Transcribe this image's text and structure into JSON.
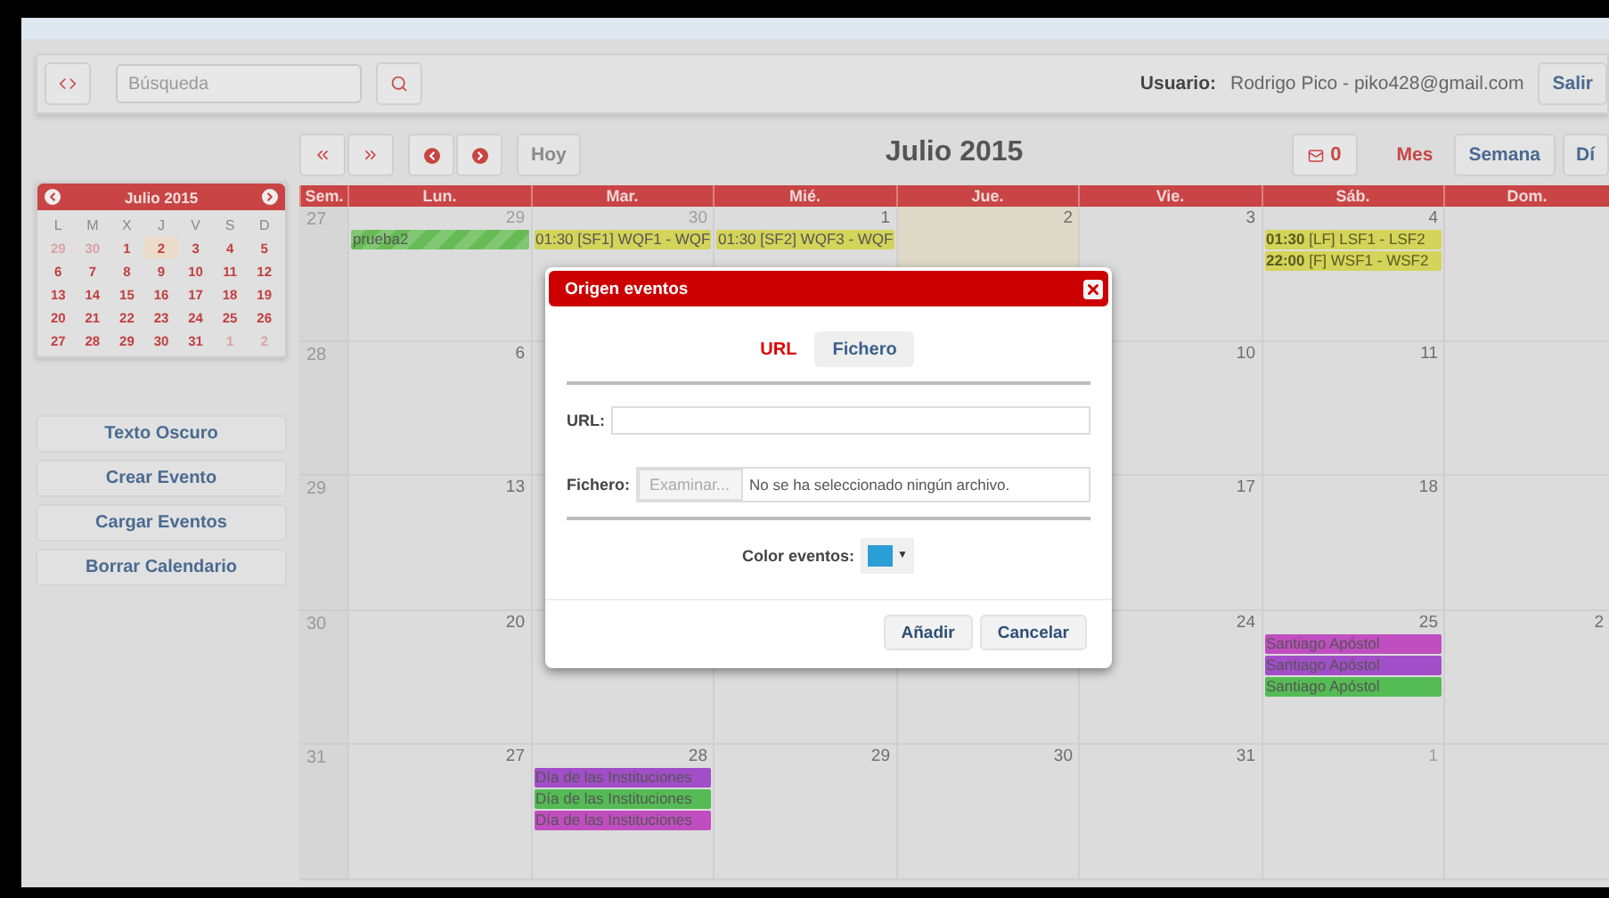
{
  "top_bar": {
    "search": {
      "placeholder": "Búsqueda"
    },
    "user_label": "Usuario:",
    "user_value": "Rodrigo Pico - piko428@gmail.com",
    "logout": "Salir"
  },
  "toolbar": {
    "today": {
      "label": "Hoy",
      "disabled": true
    },
    "title": "Julio 2015",
    "notifications": "0",
    "views": [
      {
        "label": "Mes",
        "selected": true
      },
      {
        "label": "Semana",
        "selected": false
      },
      {
        "label": "Dí",
        "selected": false
      }
    ]
  },
  "mini_calendar": {
    "title": "Julio 2015",
    "weekdays": [
      "L",
      "M",
      "X",
      "J",
      "V",
      "S",
      "D"
    ],
    "weeks": [
      [
        {
          "label": "29",
          "other_month": true,
          "today": false
        },
        {
          "label": "30",
          "other_month": true,
          "today": false
        },
        {
          "label": "1",
          "other_month": false,
          "today": false
        },
        {
          "label": "2",
          "other_month": false,
          "today": true
        },
        {
          "label": "3",
          "other_month": false,
          "today": false
        },
        {
          "label": "4",
          "other_month": false,
          "today": false
        },
        {
          "label": "5",
          "other_month": false,
          "today": false
        }
      ],
      [
        {
          "label": "6",
          "other_month": false,
          "today": false
        },
        {
          "label": "7",
          "other_month": false,
          "today": false
        },
        {
          "label": "8",
          "other_month": false,
          "today": false
        },
        {
          "label": "9",
          "other_month": false,
          "today": false
        },
        {
          "label": "10",
          "other_month": false,
          "today": false
        },
        {
          "label": "11",
          "other_month": false,
          "today": false
        },
        {
          "label": "12",
          "other_month": false,
          "today": false
        }
      ],
      [
        {
          "label": "13",
          "other_month": false,
          "today": false
        },
        {
          "label": "14",
          "other_month": false,
          "today": false
        },
        {
          "label": "15",
          "other_month": false,
          "today": false
        },
        {
          "label": "16",
          "other_month": false,
          "today": false
        },
        {
          "label": "17",
          "other_month": false,
          "today": false
        },
        {
          "label": "18",
          "other_month": false,
          "today": false
        },
        {
          "label": "19",
          "other_month": false,
          "today": false
        }
      ],
      [
        {
          "label": "20",
          "other_month": false,
          "today": false
        },
        {
          "label": "21",
          "other_month": false,
          "today": false
        },
        {
          "label": "22",
          "other_month": false,
          "today": false
        },
        {
          "label": "23",
          "other_month": false,
          "today": false
        },
        {
          "label": "24",
          "other_month": false,
          "today": false
        },
        {
          "label": "25",
          "other_month": false,
          "today": false
        },
        {
          "label": "26",
          "other_month": false,
          "today": false
        }
      ],
      [
        {
          "label": "27",
          "other_month": false,
          "today": false
        },
        {
          "label": "28",
          "other_month": false,
          "today": false
        },
        {
          "label": "29",
          "other_month": false,
          "today": false
        },
        {
          "label": "30",
          "other_month": false,
          "today": false
        },
        {
          "label": "31",
          "other_month": false,
          "today": false
        },
        {
          "label": "1",
          "other_month": true,
          "today": false
        },
        {
          "label": "2",
          "other_month": true,
          "today": false
        }
      ]
    ]
  },
  "sidebar_buttons": [
    "Texto Oscuro",
    "Crear Evento",
    "Cargar Eventos",
    "Borrar Calendario"
  ],
  "calendar": {
    "columns": [
      "Sem.",
      "Lun.",
      "Mar.",
      "Mié.",
      "Jue.",
      "Vie.",
      "Sáb.",
      "Dom."
    ],
    "weeks": [
      {
        "week": "27",
        "days": [
          {
            "kind": "day",
            "day": "29",
            "other_month": true,
            "today": false,
            "events": [
              {
                "kind": "striped",
                "text": "prueba2",
                "color": "#66bb55"
              }
            ]
          },
          {
            "kind": "day",
            "day": "30",
            "other_month": true,
            "today": false,
            "events": [
              {
                "kind": "plain",
                "text": "01:30 [SF1] WQF1 - WQF",
                "color": "#d4d45a"
              }
            ]
          },
          {
            "kind": "day",
            "day": "1",
            "other_month": false,
            "today": false,
            "events": [
              {
                "kind": "plain",
                "text": "01:30 [SF2] WQF3 - WQF",
                "color": "#d4d45a"
              }
            ]
          },
          {
            "kind": "day",
            "day": "2",
            "other_month": false,
            "today": true
          },
          {
            "kind": "day",
            "day": "3",
            "other_month": false,
            "today": false
          },
          {
            "kind": "day",
            "day": "4",
            "other_month": false,
            "today": false,
            "events": [
              {
                "kind": "timed",
                "time": "01:30",
                "text": "[LF] LSF1 - LSF2",
                "color": "#d4d45a"
              },
              {
                "kind": "timed",
                "time": "22:00",
                "text": "[F] WSF1 - WSF2",
                "color": "#d4d45a"
              }
            ]
          },
          {
            "kind": "hidden"
          }
        ]
      },
      {
        "week": "28",
        "days": [
          {
            "kind": "day",
            "day": "6",
            "other_month": false,
            "today": false
          },
          {
            "kind": "hidden"
          },
          {
            "kind": "covered"
          },
          {
            "kind": "covered"
          },
          {
            "kind": "day",
            "day": "10",
            "other_month": false,
            "today": false
          },
          {
            "kind": "day",
            "day": "11",
            "other_month": false,
            "today": false
          },
          {
            "kind": "hidden"
          }
        ]
      },
      {
        "week": "29",
        "days": [
          {
            "kind": "day",
            "day": "13",
            "other_month": false,
            "today": false
          },
          {
            "kind": "hidden"
          },
          {
            "kind": "covered"
          },
          {
            "kind": "covered"
          },
          {
            "kind": "day",
            "day": "17",
            "other_month": false,
            "today": false
          },
          {
            "kind": "day",
            "day": "18",
            "other_month": false,
            "today": false
          },
          {
            "kind": "hidden"
          }
        ]
      },
      {
        "week": "30",
        "days": [
          {
            "kind": "day",
            "day": "20",
            "other_month": false,
            "today": false
          },
          {
            "kind": "hidden"
          },
          {
            "kind": "hidden"
          },
          {
            "kind": "hidden"
          },
          {
            "kind": "day",
            "day": "24",
            "other_month": false,
            "today": false
          },
          {
            "kind": "day",
            "day": "25",
            "other_month": false,
            "today": false,
            "events": [
              {
                "kind": "plain",
                "text": "Santiago Apóstol",
                "color": "#c04ec0"
              },
              {
                "kind": "plain",
                "text": "Santiago Apóstol",
                "color": "#a24ec8"
              },
              {
                "kind": "plain",
                "text": "Santiago Apóstol",
                "color": "#55bb55"
              }
            ]
          },
          {
            "kind": "day",
            "day": "2",
            "other_month": false,
            "today": false
          }
        ]
      },
      {
        "week": "31",
        "days": [
          {
            "kind": "day",
            "day": "27",
            "other_month": false,
            "today": false
          },
          {
            "kind": "day",
            "day": "28",
            "other_month": false,
            "today": false,
            "events": [
              {
                "kind": "plain",
                "text": "Día de las Instituciones",
                "color": "#a24ec8"
              },
              {
                "kind": "plain",
                "text": "Día de las Instituciones",
                "color": "#55bb55"
              },
              {
                "kind": "plain",
                "text": "Día de las Instituciones",
                "color": "#c04ec0"
              }
            ]
          },
          {
            "kind": "day",
            "day": "29",
            "other_month": false,
            "today": false
          },
          {
            "kind": "day",
            "day": "30",
            "other_month": false,
            "today": false
          },
          {
            "kind": "day",
            "day": "31",
            "other_month": false,
            "today": false
          },
          {
            "kind": "day",
            "day": "1",
            "other_month": true,
            "today": false
          },
          {
            "kind": "hidden"
          }
        ]
      }
    ]
  },
  "dialog": {
    "title": "Origen eventos",
    "tabs": [
      {
        "label": "URL",
        "selected": true
      },
      {
        "label": "Fichero",
        "selected": false
      }
    ],
    "url_label": "URL:",
    "file_label": "Fichero:",
    "browse": "Examinar...",
    "no_file": "No se ha seleccionado ningún archivo.",
    "color_label": "Color eventos:",
    "color": "#2a9fd6",
    "caret": "▼",
    "buttons": [
      "Añadir",
      "Cancelar"
    ]
  }
}
